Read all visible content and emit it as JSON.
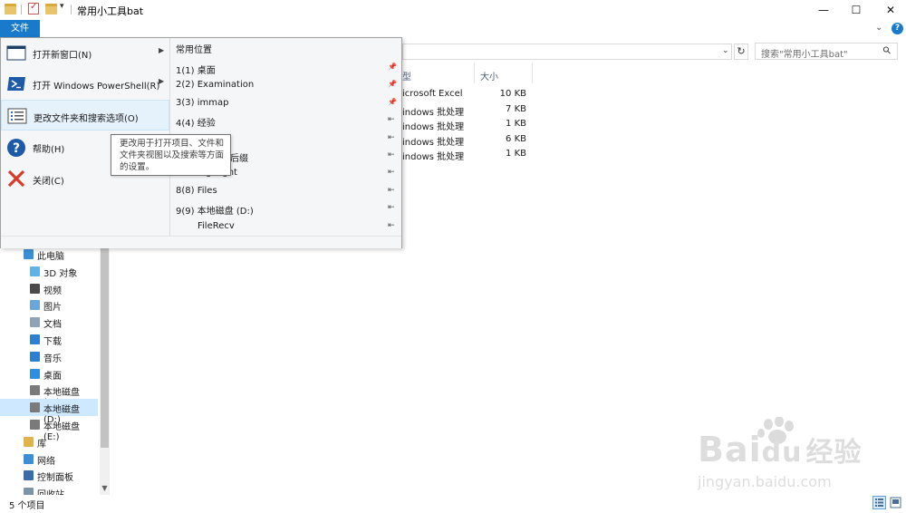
{
  "window": {
    "title": "常用小工具bat",
    "controls": {
      "minimize": "—",
      "maximize": "☐",
      "close": "✕"
    }
  },
  "ribbon": {
    "file_tab": "文件",
    "help_label": "?",
    "collapse_label": "⌄"
  },
  "address": {
    "refresh": "↻",
    "dropdown": "⌄"
  },
  "search": {
    "placeholder": "搜索\"常用小工具bat\""
  },
  "file_menu": {
    "items": [
      {
        "label": "打开新窗口(N)",
        "has_submenu": true,
        "icon": "new-window-icon"
      },
      {
        "label": "打开 Windows PowerShell(R)",
        "has_submenu": true,
        "icon": "powershell-icon"
      },
      {
        "label": "更改文件夹和搜索选项(O)",
        "has_submenu": false,
        "icon": "folder-options-icon"
      },
      {
        "label": "帮助(H)",
        "has_submenu": false,
        "icon": "help-icon"
      },
      {
        "label": "关闭(C)",
        "has_submenu": false,
        "icon": "close-icon"
      }
    ],
    "tooltip": {
      "line1": "更改用于打开项目、文件和",
      "line2": "文件夹视图以及搜索等方面",
      "line3": "的设置。"
    },
    "recent": {
      "header": "常用位置",
      "items": [
        {
          "label": "1(1)  桌面",
          "pinned": true
        },
        {
          "label": "2(2)  Examination",
          "pinned": true
        },
        {
          "label": "3(3)  immap",
          "pinned": true
        },
        {
          "label": "4(4)  经验",
          "pinned": false
        },
        {
          "label": "",
          "pinned": false
        },
        {
          "label": "后缀",
          "pinned": false
        },
        {
          "label": "highlight",
          "pinned": false
        },
        {
          "label": "8(8)  Files",
          "pinned": false
        },
        {
          "label": "9(9)  本地磁盘 (D:)",
          "pinned": false
        },
        {
          "label": "FileRecv",
          "pinned": false
        }
      ]
    }
  },
  "file_list": {
    "columns": {
      "type": "型",
      "size": "大小"
    },
    "rows": [
      {
        "type": "icrosoft Excel",
        "size": "10 KB"
      },
      {
        "type": "indows 批处理",
        "size": "7 KB"
      },
      {
        "type": "indows 批处理",
        "size": "1 KB"
      },
      {
        "type": "indows 批处理",
        "size": "6 KB"
      },
      {
        "type": "indows 批处理",
        "size": "1 KB"
      }
    ]
  },
  "nav_pane": {
    "items": [
      {
        "label": "此电脑",
        "indent": 1,
        "icon": "computer-icon",
        "color": "#3c8fd6"
      },
      {
        "label": "3D 对象",
        "indent": 2,
        "icon": "3d-objects-icon",
        "color": "#5fb3e8"
      },
      {
        "label": "视频",
        "indent": 2,
        "icon": "videos-icon",
        "color": "#4a4a4a"
      },
      {
        "label": "图片",
        "indent": 2,
        "icon": "pictures-icon",
        "color": "#6aa7d8"
      },
      {
        "label": "文档",
        "indent": 2,
        "icon": "documents-icon",
        "color": "#8fa3b8"
      },
      {
        "label": "下载",
        "indent": 2,
        "icon": "downloads-icon",
        "color": "#2f7fd1"
      },
      {
        "label": "音乐",
        "indent": 2,
        "icon": "music-icon",
        "color": "#2f7fd1"
      },
      {
        "label": "桌面",
        "indent": 2,
        "icon": "desktop-icon",
        "color": "#2f8ee0"
      },
      {
        "label": "本地磁盘 (C:)",
        "indent": 2,
        "icon": "drive-c-icon",
        "color": "#7a7a7a"
      },
      {
        "label": "本地磁盘 (D:)",
        "indent": 2,
        "icon": "drive-d-icon",
        "color": "#7a7a7a",
        "selected": true
      },
      {
        "label": "本地磁盘 (E:)",
        "indent": 2,
        "icon": "drive-e-icon",
        "color": "#7a7a7a"
      },
      {
        "label": "库",
        "indent": 1,
        "icon": "libraries-icon",
        "color": "#e0b24a"
      },
      {
        "label": "网络",
        "indent": 1,
        "icon": "network-icon",
        "color": "#3c8fd6"
      },
      {
        "label": "控制面板",
        "indent": 1,
        "icon": "control-panel-icon",
        "color": "#3b6ea8"
      },
      {
        "label": "回收站",
        "indent": 1,
        "icon": "recycle-bin-icon",
        "color": "#7d93a8"
      }
    ]
  },
  "status": {
    "count": "5 个项目"
  },
  "watermark": {
    "brand": "Bai",
    "brand2": "du",
    "cn": "经验",
    "url": "jingyan.baidu.com"
  },
  "colors": {
    "accent": "#1979ca",
    "selection": "#cde8ff",
    "menu_hover": "#e5f1fb"
  }
}
